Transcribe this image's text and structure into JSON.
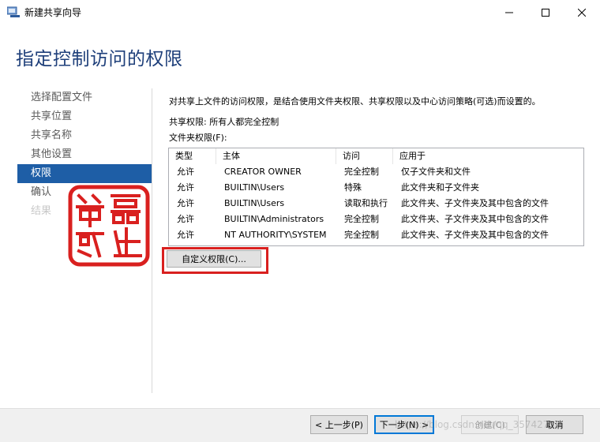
{
  "window": {
    "title": "新建共享向导",
    "heading": "指定控制访问的权限"
  },
  "nav": {
    "items": [
      {
        "label": "选择配置文件",
        "state": "normal"
      },
      {
        "label": "共享位置",
        "state": "normal"
      },
      {
        "label": "共享名称",
        "state": "normal"
      },
      {
        "label": "其他设置",
        "state": "normal"
      },
      {
        "label": "权限",
        "state": "active"
      },
      {
        "label": "确认",
        "state": "normal"
      },
      {
        "label": "结果",
        "state": "disabled"
      }
    ]
  },
  "content": {
    "description": "对共享上文件的访问权限，是结合使用文件夹权限、共享权限以及中心访问策略(可选)而设置的。",
    "share_permission": "共享权限: 所有人都完全控制",
    "folder_permission_label": "文件夹权限(F):",
    "table": {
      "headers": [
        "类型",
        "主体",
        "访问",
        "应用于"
      ],
      "rows": [
        [
          "允许",
          "CREATOR OWNER",
          "完全控制",
          "仅子文件夹和文件"
        ],
        [
          "允许",
          "BUILTIN\\Users",
          "特殊",
          "此文件夹和子文件夹"
        ],
        [
          "允许",
          "BUILTIN\\Users",
          "读取和执行",
          "此文件夹、子文件夹及其中包含的文件"
        ],
        [
          "允许",
          "BUILTIN\\Administrators",
          "完全控制",
          "此文件夹、子文件夹及其中包含的文件"
        ],
        [
          "允许",
          "NT AUTHORITY\\SYSTEM",
          "完全控制",
          "此文件夹、子文件夹及其中包含的文件"
        ]
      ]
    },
    "custom_button": "自定义权限(C)..."
  },
  "footer": {
    "back": "< 上一步(P)",
    "next": "下一步(N) >",
    "create": "创建(C)",
    "cancel": "取消"
  },
  "watermark": "https://blog.csdn.net/qq_35742750",
  "colors": {
    "heading": "#1e3f7a",
    "nav_active": "#1e5ea6",
    "highlight": "#d9201f",
    "seal": "#d9201f"
  },
  "seal_text": "嬴生笔记"
}
